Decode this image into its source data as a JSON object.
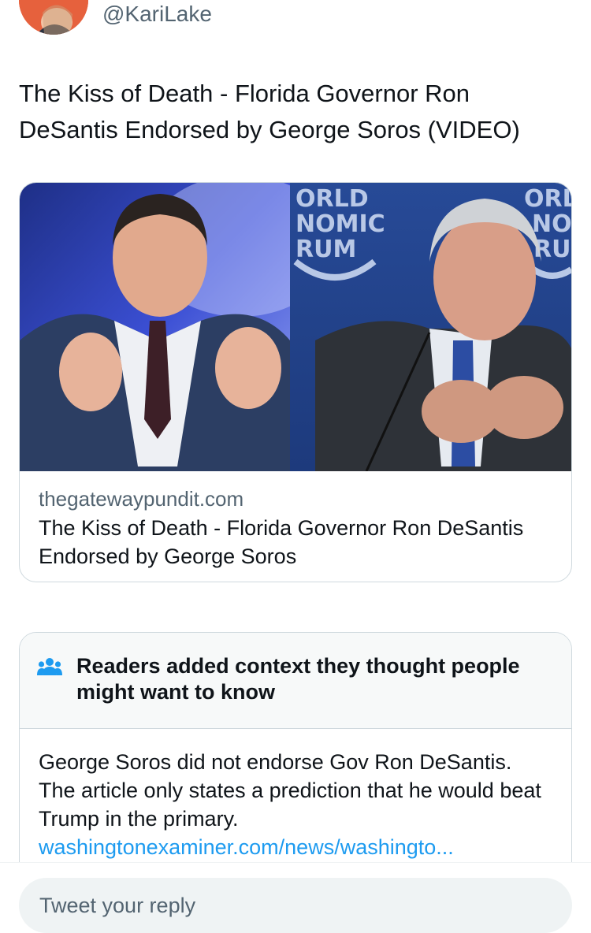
{
  "tweet": {
    "handle": "@KariLake",
    "text": "The Kiss of Death - Florida Governor Ron DeSantis Endorsed by George Soros (VIDEO)"
  },
  "link_card": {
    "image_watermark_left": [
      "ORLD",
      "NOMIC",
      "RUM"
    ],
    "image_watermark_right": [
      "ORLI",
      "NOM",
      "RUM"
    ],
    "domain": "thegatewaypundit.com",
    "title": "The Kiss of Death - Florida Governor Ron DeSantis Endorsed by George Soros"
  },
  "community_note": {
    "icon": "people-group-icon",
    "heading": "Readers added context they thought people might want to know",
    "body": "George Soros did not endorse Gov Ron DeSantis. The article only states a prediction that he would beat Trump in the primary.",
    "link": "washingtonexaminer.com/news/washingto..."
  },
  "reply": {
    "placeholder": "Tweet your reply"
  },
  "colors": {
    "accent": "#1d9bf0",
    "text": "#0f1419",
    "muted": "#536471",
    "border": "#cfd9de",
    "note_header_bg": "#f7f9f9"
  }
}
